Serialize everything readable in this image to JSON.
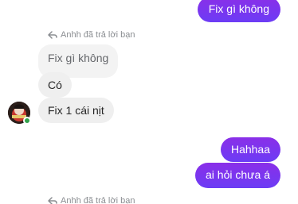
{
  "messages": {
    "top_outgoing": "Fix gì không",
    "reply_note_1": "Anhh đã trả lời bạn",
    "quoted": "Fix gì không",
    "in_1": "Có",
    "in_2": "Fix 1 cái nịt",
    "out_1": "Hahhaa",
    "out_2": "ai hỏi chưa á",
    "reply_note_2": "Anhh đã trả lời bạn"
  },
  "icons": {
    "reply": "reply-arrow-icon",
    "online": "online-status-icon"
  },
  "colors": {
    "outgoing_bubble": "#7b35f0",
    "incoming_bubble": "#efefef",
    "online": "#31a24c"
  }
}
